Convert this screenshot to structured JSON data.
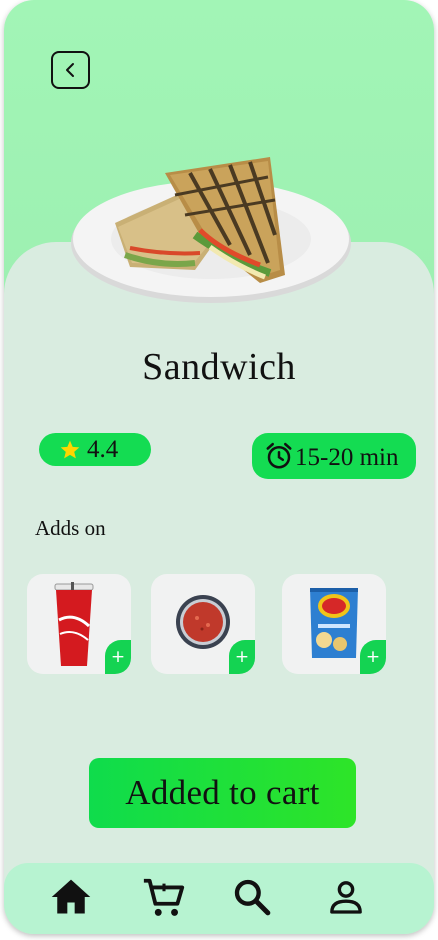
{
  "header": {
    "back_icon": "chevron-left-icon"
  },
  "product": {
    "name": "Sandwich",
    "rating": "4.4",
    "rating_icon": "star-icon",
    "prep_time": "15-20 min",
    "time_icon": "alarm-clock-icon"
  },
  "addons": {
    "title": "Adds on",
    "items": [
      {
        "icon": "cola-cup-icon",
        "plus": "+"
      },
      {
        "icon": "tomato-soup-icon",
        "plus": "+"
      },
      {
        "icon": "chips-bag-icon",
        "plus": "+"
      }
    ]
  },
  "cart_button": {
    "label": "Added to cart"
  },
  "nav": {
    "items": [
      {
        "icon": "home-icon"
      },
      {
        "icon": "cart-icon"
      },
      {
        "icon": "search-icon"
      },
      {
        "icon": "profile-icon"
      }
    ]
  },
  "colors": {
    "accent_green": "#14dc52",
    "header_green": "#a2f5b6",
    "card_bg": "#d9ece0",
    "nav_bg": "#b7f3d1"
  }
}
